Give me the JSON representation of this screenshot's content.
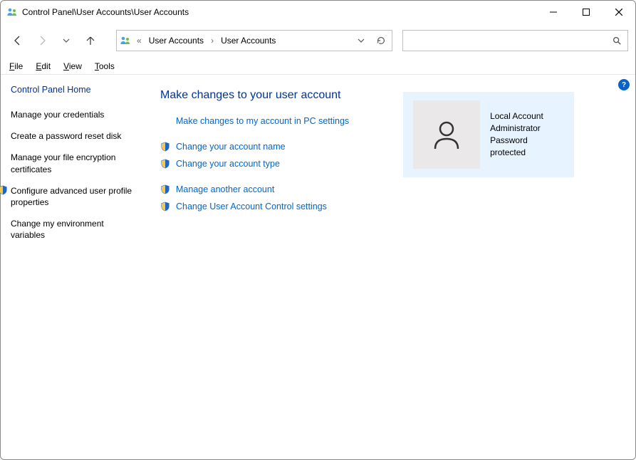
{
  "window": {
    "title": "Control Panel\\User Accounts\\User Accounts"
  },
  "breadcrumb": {
    "items": [
      "User Accounts",
      "User Accounts"
    ]
  },
  "menu": {
    "file": "File",
    "edit": "Edit",
    "view": "View",
    "tools": "Tools"
  },
  "sidebar": {
    "home": "Control Panel Home",
    "items": [
      {
        "label": "Manage your credentials",
        "shield": false
      },
      {
        "label": "Create a password reset disk",
        "shield": false
      },
      {
        "label": "Manage your file encryption certificates",
        "shield": false
      },
      {
        "label": "Configure advanced user profile properties",
        "shield": true
      },
      {
        "label": "Change my environment variables",
        "shield": false
      }
    ]
  },
  "main": {
    "heading": "Make changes to your user account",
    "group1": [
      {
        "label": "Make changes to my account in PC settings",
        "shield": false
      }
    ],
    "group2": [
      {
        "label": "Change your account name",
        "shield": true
      },
      {
        "label": "Change your account type",
        "shield": true
      }
    ],
    "group3": [
      {
        "label": "Manage another account",
        "shield": true
      },
      {
        "label": "Change User Account Control settings",
        "shield": true
      }
    ]
  },
  "account": {
    "line1": "Local Account",
    "line2": "Administrator",
    "line3": "Password protected"
  },
  "search": {
    "placeholder": ""
  }
}
